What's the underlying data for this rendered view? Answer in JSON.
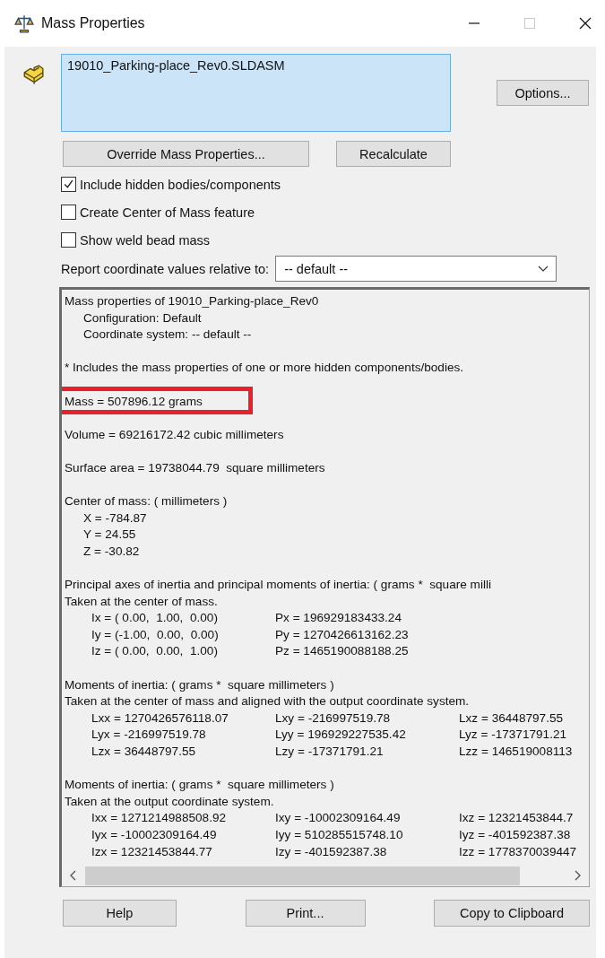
{
  "window": {
    "title": "Mass Properties"
  },
  "selection": {
    "items": [
      "19010_Parking-place_Rev0.SLDASM"
    ]
  },
  "buttons_top": [
    {
      "label": "Options...",
      "kind": "side"
    },
    {
      "label": "Override Mass Properties...",
      "kind": "wide"
    },
    {
      "label": "Recalculate",
      "kind": "narrow"
    }
  ],
  "checkboxes": [
    {
      "label": "Include hidden bodies/components",
      "checked": true
    },
    {
      "label": "Create Center of Mass feature",
      "checked": false
    },
    {
      "label": "Show weld bead mass",
      "checked": false
    }
  ],
  "coordinate": {
    "label": "Report coordinate values relative to:",
    "value": "-- default --"
  },
  "report": {
    "sections": [
      {
        "lines": [
          {
            "kind": "text",
            "text": "Mass properties of 19010_Parking-place_Rev0"
          },
          {
            "kind": "detail",
            "text": "Configuration: Default"
          },
          {
            "kind": "detail",
            "text": "Coordinate system: -- default --"
          }
        ]
      },
      {
        "lines": [
          {
            "kind": "text",
            "text": "* Includes the mass properties of one or more hidden components/bodies."
          }
        ]
      },
      {
        "lines": [
          {
            "kind": "text",
            "text": "Mass = 507896.12 grams",
            "highlighted": true
          }
        ]
      },
      {
        "lines": [
          {
            "kind": "text",
            "text": "Volume = 69216172.42 cubic millimeters"
          }
        ]
      },
      {
        "lines": [
          {
            "kind": "text",
            "text": "Surface area = 19738044.79  square millimeters"
          }
        ]
      },
      {
        "lines": [
          {
            "kind": "text",
            "text": "Center of mass: ( millimeters )"
          },
          {
            "kind": "detail",
            "text": "X = -784.87"
          },
          {
            "kind": "detail",
            "text": "Y = 24.55"
          },
          {
            "kind": "detail",
            "text": "Z = -30.82"
          }
        ]
      },
      {
        "lines": [
          {
            "kind": "text",
            "text": "Principal axes of inertia and principal moments of inertia: ( grams *  square milli"
          },
          {
            "kind": "text",
            "text": "Taken at the center of mass."
          },
          {
            "kind": "row",
            "cells": [
              "Ix = ( 0.00,  1.00,  0.00)",
              "Px = 196929183433.24"
            ]
          },
          {
            "kind": "row",
            "cells": [
              "Iy = (-1.00,  0.00,  0.00)",
              "Py = 1270426613162.23"
            ]
          },
          {
            "kind": "row",
            "cells": [
              "Iz = ( 0.00,  0.00,  1.00)",
              "Pz = 1465190088188.25"
            ]
          }
        ]
      },
      {
        "lines": [
          {
            "kind": "text",
            "text": "Moments of inertia: ( grams *  square millimeters )"
          },
          {
            "kind": "text",
            "text": "Taken at the center of mass and aligned with the output coordinate system."
          },
          {
            "kind": "row",
            "cells": [
              "Lxx = 1270426576118.07",
              "Lxy = -216997519.78",
              "Lxz = 36448797.55"
            ]
          },
          {
            "kind": "row",
            "cells": [
              "Lyx = -216997519.78",
              "Lyy = 196929227535.42",
              "Lyz = -17371791.21"
            ]
          },
          {
            "kind": "row",
            "cells": [
              "Lzx = 36448797.55",
              "Lzy = -17371791.21",
              "Lzz = 146519008113"
            ]
          }
        ]
      },
      {
        "lines": [
          {
            "kind": "text",
            "text": "Moments of inertia: ( grams *  square millimeters )"
          },
          {
            "kind": "text",
            "text": "Taken at the output coordinate system."
          },
          {
            "kind": "row",
            "cells": [
              "Ixx = 1271214988508.92",
              "Ixy = -10002309164.49",
              "Ixz = 12321453844.7"
            ]
          },
          {
            "kind": "row",
            "cells": [
              "Iyx = -10002309164.49",
              "Iyy = 510285515748.10",
              "Iyz = -401592387.38"
            ]
          },
          {
            "kind": "row",
            "cells": [
              "Izx = 12321453844.77",
              "Izy = -401592387.38",
              "Izz = 1778370039447"
            ]
          }
        ]
      }
    ]
  },
  "buttons_bottom": [
    "Help",
    "Print...",
    "Copy to Clipboard"
  ]
}
